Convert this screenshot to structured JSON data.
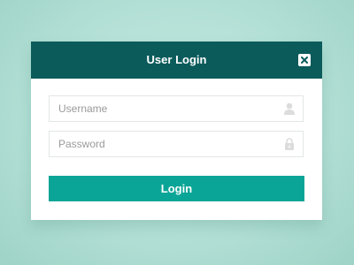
{
  "dialog": {
    "title": "User Login",
    "close_icon": "close-icon"
  },
  "form": {
    "username": {
      "placeholder": "Username",
      "value": "",
      "icon": "user-icon"
    },
    "password": {
      "placeholder": "Password",
      "value": "",
      "icon": "lock-icon"
    },
    "submit_label": "Login"
  },
  "colors": {
    "background": "#b3e0d6",
    "header": "#0b5b5b",
    "accent": "#0ba597",
    "field_border": "#e3e6e6",
    "icon_gray": "#dcdcdc"
  }
}
